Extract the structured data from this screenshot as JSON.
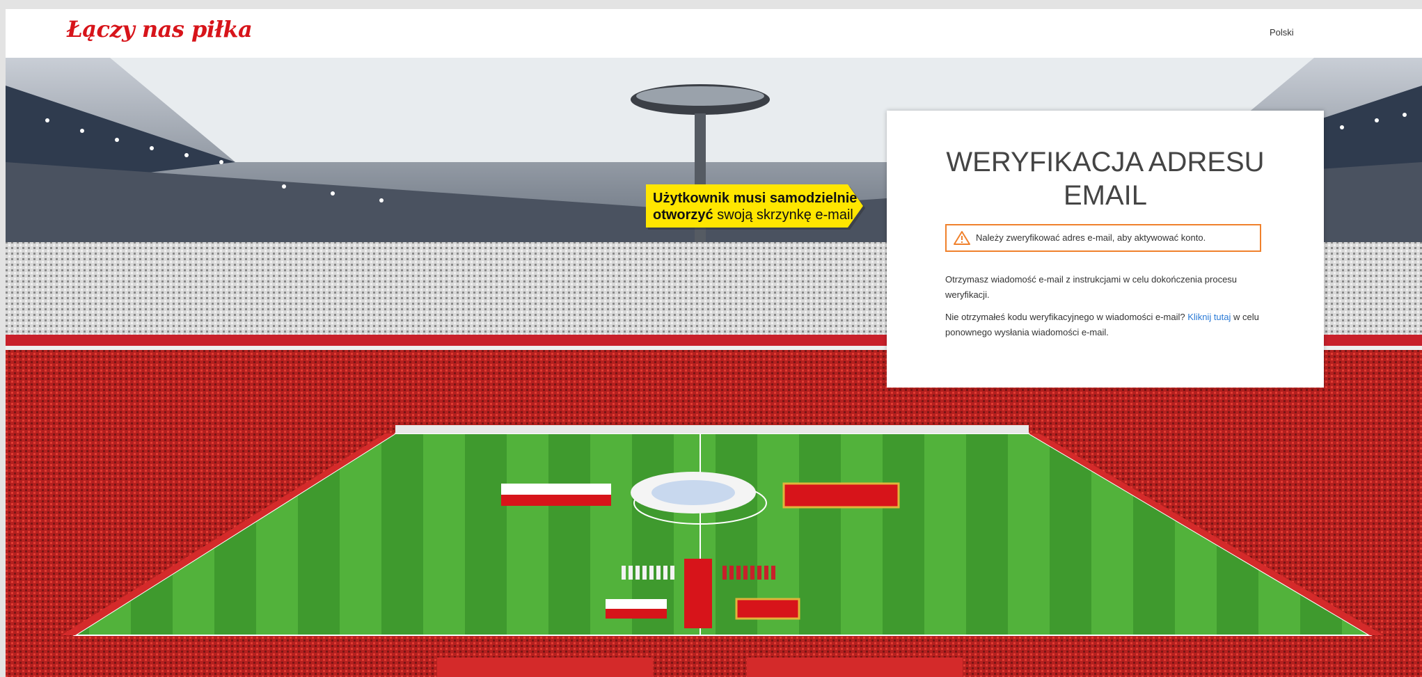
{
  "header": {
    "logo_text": "Łączy nas piłka",
    "language": "Polski"
  },
  "callout": {
    "bold_line1": "Użytkownik musi samodzielnie",
    "bold_line2_start": "otworzyć",
    "rest": " swoją skrzynkę e-mail"
  },
  "card": {
    "title": "WERYFIKACJA ADRESU EMAIL",
    "alert": {
      "icon": "warning-icon",
      "text": "Należy zweryfikować adres e-mail, aby aktywować konto."
    },
    "paragraph1": "Otrzymasz wiadomość e-mail z instrukcjami w celu dokończenia procesu weryfikacji.",
    "paragraph2_before": "Nie otrzymałeś kodu weryfikacyjnego w wiadomości e-mail? ",
    "resend_link": "Kliknij tutaj",
    "paragraph2_after": " w celu ponownego wysłania wiadomości e-mail."
  },
  "colors": {
    "brand_red": "#d7141a",
    "alert_orange": "#f0812c",
    "link_blue": "#2a7ad6",
    "callout_yellow": "#ffe600",
    "pitch_green": "#3f9a2e"
  }
}
